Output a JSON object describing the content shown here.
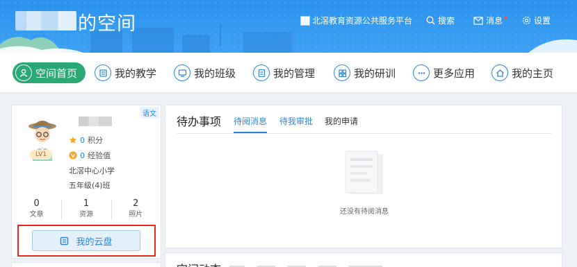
{
  "header": {
    "space_title": "的空间",
    "platform_link": "北滘教育资源公共服务平台",
    "search_label": "搜索",
    "messages_label": "消息",
    "settings_label": "设置"
  },
  "nav": {
    "items": [
      {
        "label": "空间首页",
        "icon": "user-icon",
        "active": true
      },
      {
        "label": "我的教学",
        "icon": "book-icon"
      },
      {
        "label": "我的班级",
        "icon": "monitor-icon"
      },
      {
        "label": "我的管理",
        "icon": "document-icon"
      },
      {
        "label": "我的研训",
        "icon": "grid-icon"
      },
      {
        "label": "更多应用",
        "icon": "more-icon"
      },
      {
        "label": "我的主页",
        "icon": "home-icon"
      }
    ]
  },
  "profile": {
    "subject_tag": "语文",
    "level": "LV1",
    "points_value": "0",
    "points_label": "积分",
    "exp_value": "0",
    "exp_label": "经验值",
    "school": "北滘中心小学",
    "class_name": "五年级(4)班",
    "stats": [
      {
        "value": "0",
        "label": "文章"
      },
      {
        "value": "1",
        "label": "资源"
      },
      {
        "value": "2",
        "label": "照片"
      }
    ],
    "cloud_button": "我的云盘"
  },
  "todo": {
    "heading": "待办事项",
    "tabs": [
      {
        "label": "待阅消息",
        "active": true
      },
      {
        "label": "待我审批",
        "active": true
      },
      {
        "label": "我的申请",
        "active": false
      }
    ],
    "empty_text": "还没有待阅消息"
  },
  "dynamics": {
    "heading": "空间动态"
  },
  "colors": {
    "banner_blue": "#2a93f0",
    "active_green": "#2aa876",
    "link_blue": "#2a86dc",
    "highlight_red": "#e8261e"
  }
}
